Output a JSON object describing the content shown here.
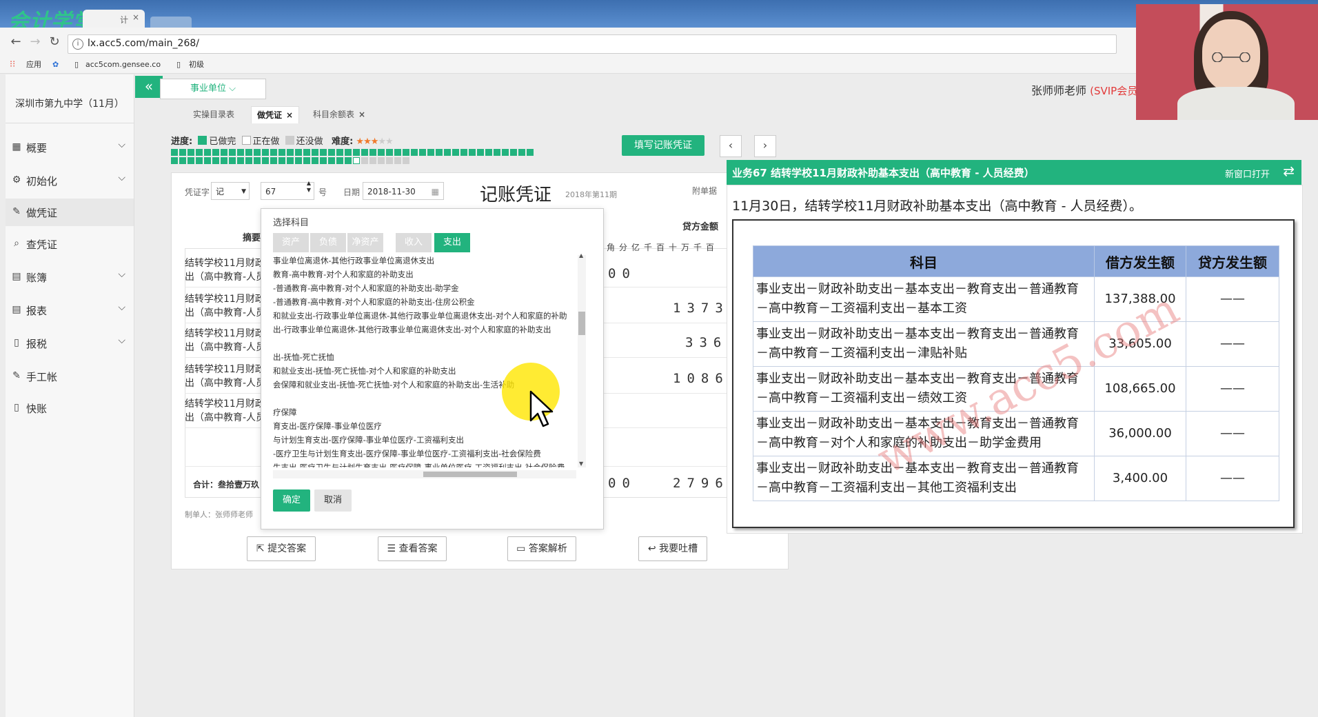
{
  "browser": {
    "logo": "会计学堂",
    "tab_suffix": "计",
    "tab_close": "×",
    "url": "lx.acc5.com/main_268/",
    "bookmarks": [
      "应用",
      "acc5com.gensee.co",
      "初级"
    ]
  },
  "sidebar": {
    "school": "深圳市第九中学（11月）",
    "items": [
      {
        "label": "概要",
        "icon": "grid-icon",
        "chevron": true
      },
      {
        "label": "初始化",
        "icon": "gear-icon",
        "chevron": true
      },
      {
        "label": "做凭证",
        "icon": "pen-icon",
        "chevron": false,
        "active": true
      },
      {
        "label": "查凭证",
        "icon": "search-icon",
        "chevron": false
      },
      {
        "label": "账簿",
        "icon": "book-icon",
        "chevron": true
      },
      {
        "label": "报表",
        "icon": "report-icon",
        "chevron": true
      },
      {
        "label": "报税",
        "icon": "file-icon",
        "chevron": true
      },
      {
        "label": "手工帐",
        "icon": "pen-icon",
        "chevron": false
      },
      {
        "label": "快账",
        "icon": "file-icon",
        "chevron": false
      }
    ]
  },
  "header": {
    "collapse": "«",
    "unit_select": "事业单位 ⌵",
    "teacher": "张师师老师",
    "svip": "(SVIP会员"
  },
  "page_tabs": [
    {
      "label": "实操目录表",
      "active": false,
      "closable": false
    },
    {
      "label": "做凭证",
      "active": true,
      "closable": true
    },
    {
      "label": "科目余额表",
      "active": false,
      "closable": true
    }
  ],
  "progress": {
    "label": "进度:",
    "done": "已做完",
    "doing": "正在做",
    "not_done": "还没做",
    "difficulty": "难度:",
    "stars_filled": 3,
    "stars_total": 5,
    "total_cells": 67,
    "done_cells": 66,
    "current_cell": 67
  },
  "toolbar": {
    "fill_button": "填写记账凭证",
    "prev": "‹",
    "next": "›"
  },
  "voucher": {
    "word_label": "凭证字",
    "word_value": "记",
    "number_value": "67",
    "number_suffix": "号",
    "date_label": "日期",
    "date_value": "2018-11-30",
    "title": "记账凭证",
    "period": "2018年第11期",
    "attachments_label": "附单据",
    "col_summary": "摘要",
    "col_credit": "贷方金额",
    "units": [
      "角",
      "分",
      "亿",
      "千",
      "百",
      "十",
      "万",
      "千",
      "百"
    ],
    "rows": [
      {
        "line1": "结转学校11月财政",
        "line2": "出（高中教育-人员",
        "amount": "00"
      },
      {
        "line1": "结转学校11月财政",
        "line2": "出（高中教育-人员",
        "amount": "1373"
      },
      {
        "line1": "结转学校11月财政",
        "line2": "出（高中教育-人员",
        "amount": "336"
      },
      {
        "line1": "结转学校11月财政",
        "line2": "出（高中教育-人员",
        "amount": "1086"
      },
      {
        "line1": "结转学校11月财政",
        "line2": "出（高中教育-人员",
        "amount": ""
      }
    ],
    "total_label": "合计：叁拾壹万玖",
    "total_amount_left": "00",
    "total_amount": "2796",
    "maker": "制单人：张师师老师"
  },
  "actions": {
    "submit": "提交答案",
    "view": "查看答案",
    "explain": "答案解析",
    "feedback": "我要吐槽"
  },
  "account_modal": {
    "title": "选择科目",
    "tabs": [
      "资产",
      "负债",
      "净资产",
      "收入",
      "支出"
    ],
    "active_tab": "支出",
    "items": [
      "事业单位离退休-其他行政事业单位离退休支出",
      "教育-高中教育-对个人和家庭的补助支出",
      "-普通教育-高中教育-对个人和家庭的补助支出-助学金",
      "-普通教育-高中教育-对个人和家庭的补助支出-住房公积金",
      "和就业支出-行政事业单位离退休-其他行政事业单位离退休支出-对个人和家庭的补助",
      "出-行政事业单位离退休-其他行政事业单位离退休支出-对个人和家庭的补助支出",
      "",
      "出-抚恤-死亡抚恤",
      "和就业支出-抚恤-死亡抚恤-对个人和家庭的补助支出",
      "会保障和就业支出-抚恤-死亡抚恤-对个人和家庭的补助支出-生活补助",
      "",
      "疗保障",
      "育支出-医疗保障-事业单位医疗",
      "与计划生育支出-医疗保障-事业单位医疗-工资福利支出",
      "-医疗卫生与计划生育支出-医疗保障-事业单位医疗-工资福利支出-社会保险费",
      "生支出-医疗卫生与计划生育支出-医疗保障-事业单位医疗-工资福利支出-社会保险费"
    ],
    "confirm": "确定",
    "cancel": "取消"
  },
  "task": {
    "header": "业务67 结转学校11月财政补助基本支出（高中教育 - 人员经费）",
    "new_window": "新窗口打开",
    "description": "11月30日，结转学校11月财政补助基本支出（高中教育 - 人员经费）。",
    "table_headers": [
      "科目",
      "借方发生额",
      "贷方发生额"
    ],
    "rows": [
      {
        "line1": "事业支出－财政补助支出－基本支出－教育支出－普通教育",
        "line2": "－高中教育－工资福利支出－基本工资",
        "debit": "137,388.00",
        "credit": "——"
      },
      {
        "line1": "事业支出－财政补助支出－基本支出－教育支出－普通教育",
        "line2": "－高中教育－工资福利支出－津贴补贴",
        "debit": "33,605.00",
        "credit": "——"
      },
      {
        "line1": "事业支出－财政补助支出－基本支出－教育支出－普通教育",
        "line2": "－高中教育－工资福利支出－绩效工资",
        "debit": "108,665.00",
        "credit": "——"
      },
      {
        "line1": "事业支出－财政补助支出－基本支出－教育支出－普通教育",
        "line2": "－高中教育－对个人和家庭的补助支出－助学金费用",
        "debit": "36,000.00",
        "credit": "——"
      },
      {
        "line1": "事业支出－财政补助支出－基本支出－教育支出－普通教育",
        "line2": "－高中教育－工资福利支出－其他工资福利支出",
        "debit": "3,400.00",
        "credit": "——"
      }
    ],
    "watermark": "www.acc5.com"
  }
}
